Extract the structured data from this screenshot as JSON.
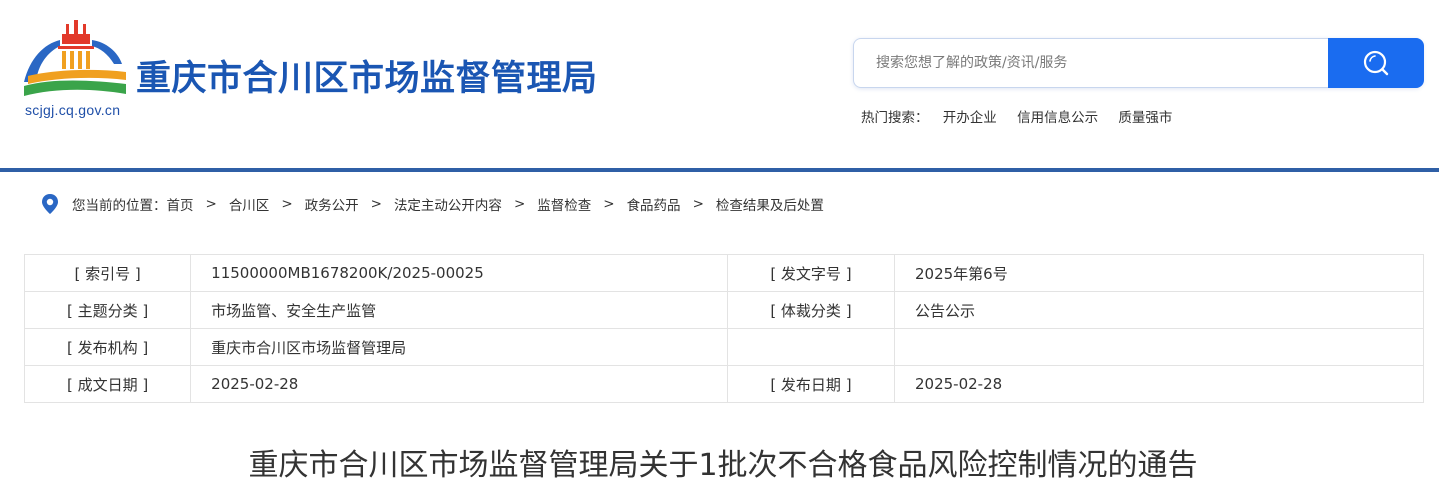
{
  "header": {
    "site_title": "重庆市合川区市场监督管理局",
    "site_domain": "scjgj.cq.gov.cn",
    "logo_icon": "building-emblem-icon",
    "search": {
      "placeholder": "搜索您想了解的政策/资讯/服务",
      "value": "",
      "button_icon": "search-icon"
    },
    "hot_search": {
      "label": "热门搜索：",
      "items": [
        "开办企业",
        "信用信息公示",
        "质量强市"
      ]
    }
  },
  "breadcrumb": {
    "icon": "location-pin-icon",
    "prefix": "您当前的位置：",
    "separator": ">",
    "items": [
      "首页",
      "合川区",
      "政务公开",
      "法定主动公开内容",
      "监督检查",
      "食品药品",
      "检查结果及后处置"
    ]
  },
  "meta": {
    "rows": [
      {
        "label1": "[ 索引号 ]",
        "value1": "11500000MB1678200K/2025-00025",
        "label2": "[ 发文字号 ]",
        "value2": "2025年第6号"
      },
      {
        "label1": "[ 主题分类 ]",
        "value1": "市场监管、安全生产监管",
        "label2": "[ 体裁分类 ]",
        "value2": "公告公示"
      },
      {
        "label1": "[ 发布机构 ]",
        "value1": "重庆市合川区市场监督管理局",
        "label2": "",
        "value2": ""
      },
      {
        "label1": "[ 成文日期 ]",
        "value1": "2025-02-28",
        "label2": "[ 发布日期 ]",
        "value2": "2025-02-28"
      }
    ]
  },
  "article": {
    "title": "重庆市合川区市场监督管理局关于1批次不合格食品风险控制情况的通告"
  },
  "colors": {
    "brand_blue": "#1a56b3",
    "search_button": "#1a6cf0",
    "header_rule": "#2f5fa6",
    "logo_orange": "#f0a020",
    "logo_red": "#e2392a",
    "logo_green": "#3aa44a"
  }
}
